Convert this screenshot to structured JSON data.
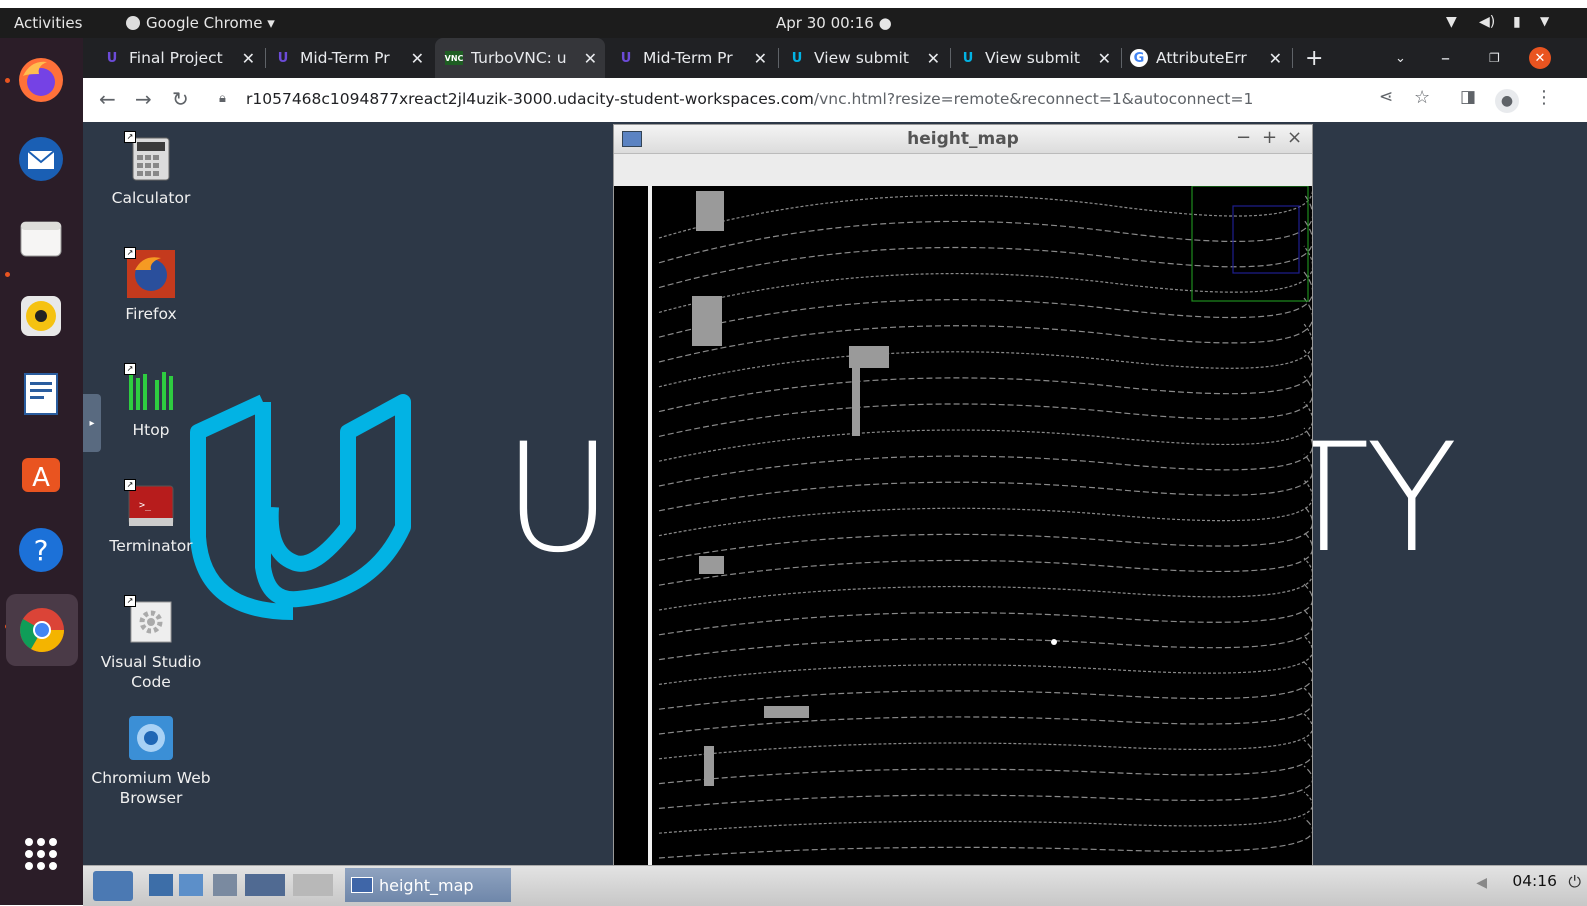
{
  "topbar": {
    "activities": "Activities",
    "app_menu": "Google Chrome ▾",
    "clock": "Apr 30  00:16  ●"
  },
  "chrome": {
    "tabs": [
      {
        "label": "Final Project",
        "favicon": "udacity-icon",
        "color": "#6c4bd8"
      },
      {
        "label": "Mid-Term Pr",
        "favicon": "udacity-icon",
        "color": "#6c4bd8"
      },
      {
        "label": "TurboVNC: u",
        "favicon": "vnc-icon",
        "color": "#2e7d32",
        "active": true
      },
      {
        "label": "Mid-Term Pr",
        "favicon": "udacity-icon",
        "color": "#6c4bd8"
      },
      {
        "label": "View submit",
        "favicon": "udacity-icon",
        "color": "#02b3e4"
      },
      {
        "label": "View submit",
        "favicon": "udacity-icon",
        "color": "#02b3e4"
      },
      {
        "label": "AttributeErr",
        "favicon": "google-icon",
        "color": "#ffffff"
      }
    ],
    "new_tab": "+",
    "url_host": "r1057468c1094877xreact2jl4uzik-3000.udacity-student-workspaces.com",
    "url_rest": "/vnc.html?resize=remote&reconnect=1&autoconnect=1"
  },
  "desktop": {
    "icons": [
      {
        "label": "Calculator"
      },
      {
        "label": "Firefox"
      },
      {
        "label": "Htop"
      },
      {
        "label": "Terminator"
      },
      {
        "label": "Visual Studio Code"
      },
      {
        "label": "Chromium Web Browser"
      }
    ],
    "brand_letters": [
      "U",
      "T",
      "Y"
    ]
  },
  "window": {
    "title": "height_map",
    "min": "−",
    "max": "+",
    "close": "×"
  },
  "panel": {
    "task_label": "height_map",
    "clock": "04:16"
  }
}
